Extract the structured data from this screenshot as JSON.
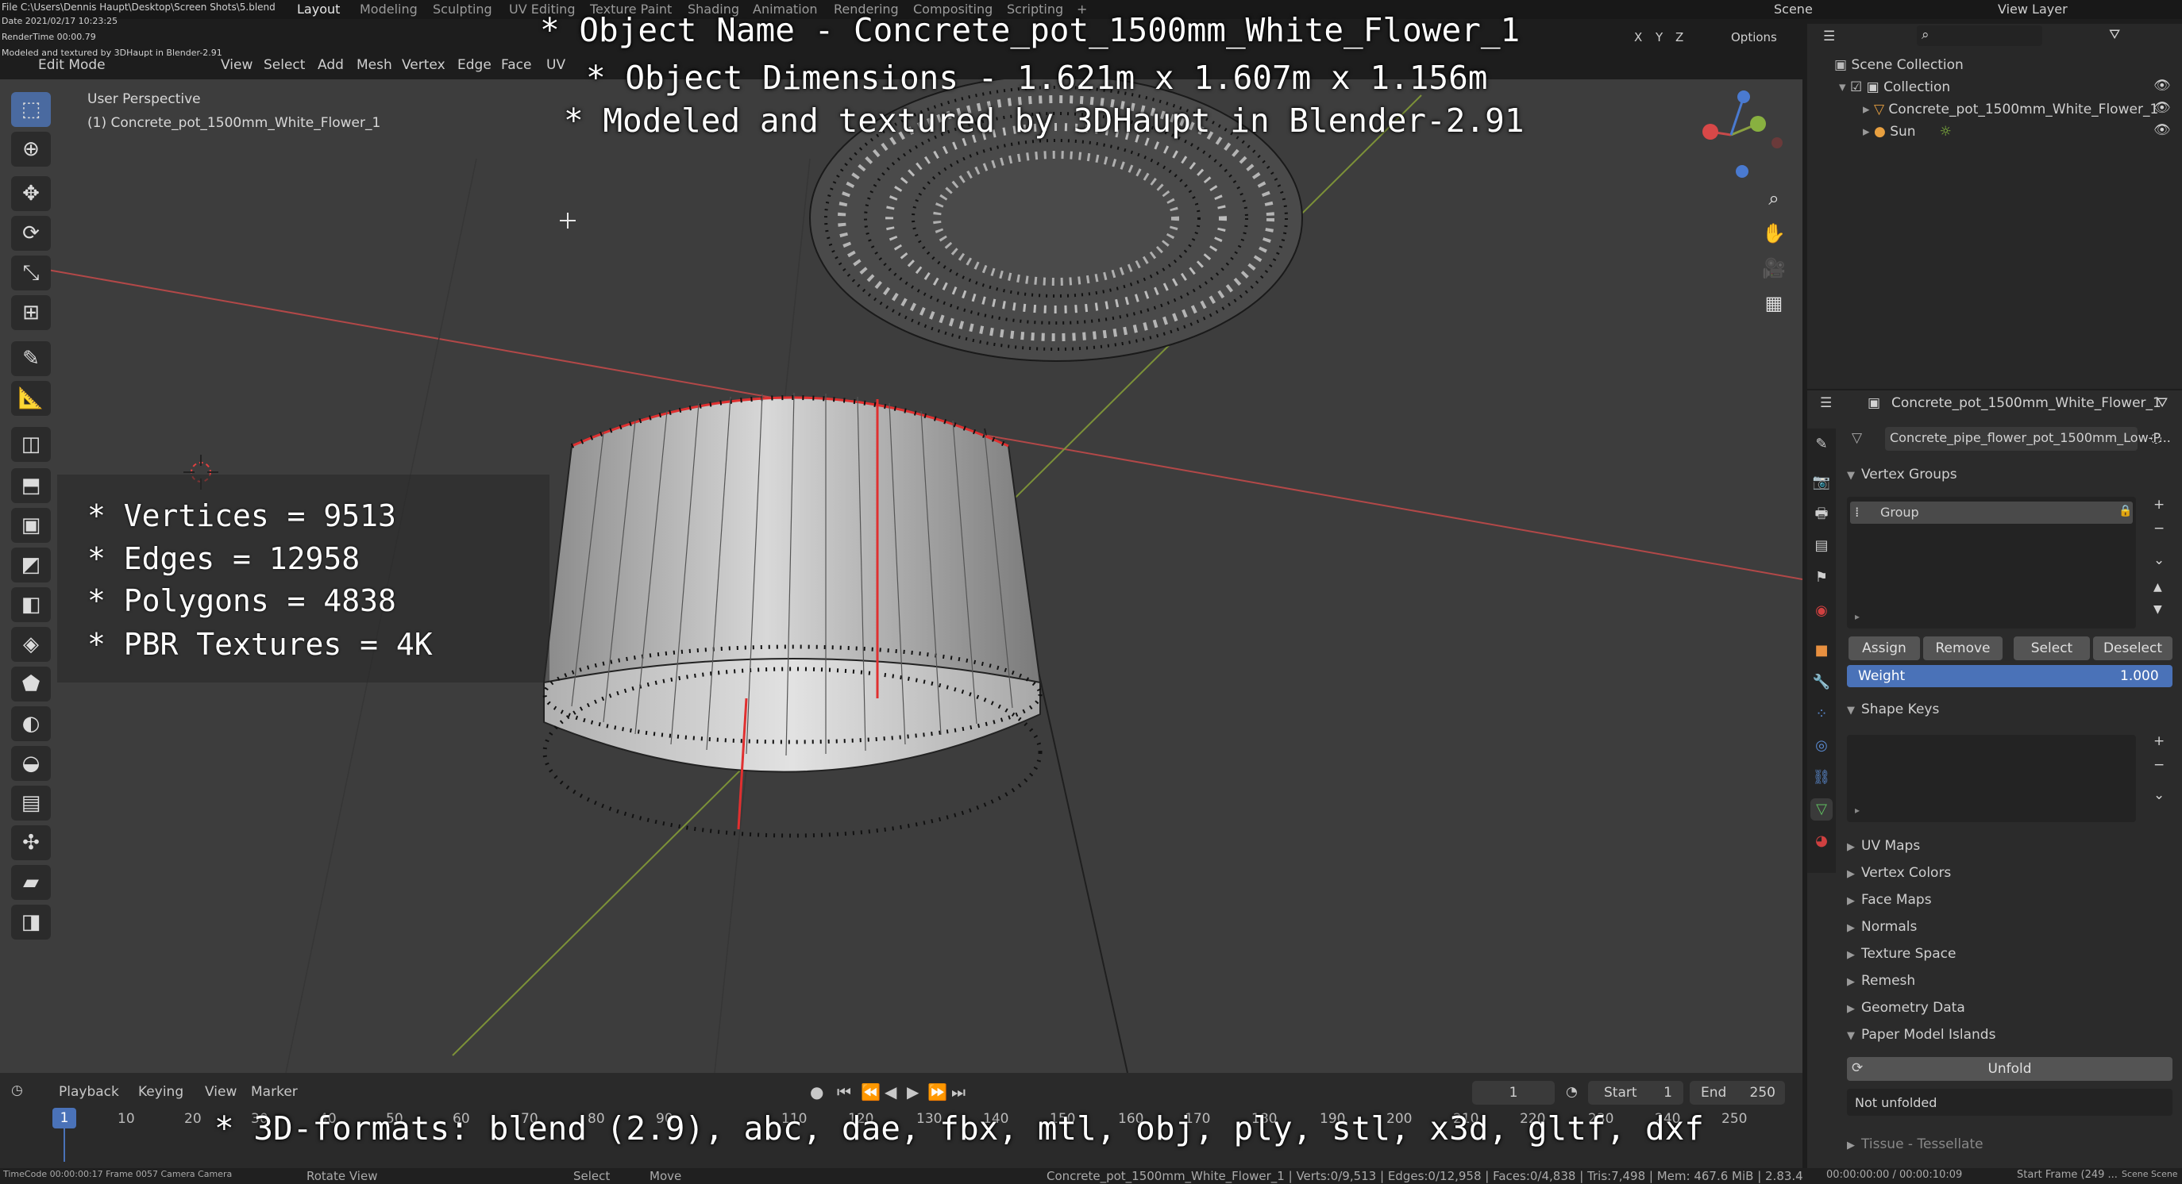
{
  "topbar": {
    "file_path": "File C:\\Users\\Dennis Haupt\\Desktop\\Screen Shots\\5.blend",
    "date": "Date 2021/02/17 10:23:25",
    "rendertime": "RenderTime 00:00.79",
    "note": "Modeled and textured by 3DHaupt in Blender-2.91",
    "tabs": [
      "Layout",
      "Modeling",
      "Sculpting",
      "UV Editing",
      "Texture Paint",
      "Shading",
      "Animation",
      "Rendering",
      "Compositing",
      "Scripting"
    ],
    "active_tab": "Layout",
    "scene": "Scene",
    "view_layer": "View Layer"
  },
  "viewport_header": {
    "mode": "Edit Mode",
    "menus": [
      "View",
      "Select",
      "Add",
      "Mesh",
      "Vertex",
      "Edge",
      "Face",
      "UV"
    ],
    "options": "Options",
    "axes": [
      "X",
      "Y",
      "Z"
    ]
  },
  "viewport": {
    "perspective": "User Perspective",
    "object_caption": "(1) Concrete_pot_1500mm_White_Flower_1"
  },
  "overlay": {
    "line1": "* Object Name - Concrete_pot_1500mm_White_Flower_1",
    "line2": "* Object Dimensions -  1.621m x 1.607m x 1.156m",
    "line3": "* Modeled and textured by 3DHaupt in Blender-2.91",
    "stats": [
      "* Vertices = 9513",
      "* Edges = 12958",
      "* Polygons = 4838",
      "* PBR Textures = 4K"
    ],
    "formats": "* 3D-formats: blend (2.9), abc, dae, fbx, mtl, obj, ply, stl, x3d, gltf, dxf"
  },
  "timeline": {
    "menus": [
      "Playback",
      "Keying",
      "View",
      "Marker"
    ],
    "current_frame": "1",
    "start_label": "Start",
    "start_value": "1",
    "end_label": "End",
    "end_value": "250",
    "ruler": [
      "10",
      "20",
      "30",
      "40",
      "50",
      "60",
      "70",
      "80",
      "90",
      "110",
      "120",
      "130",
      "140",
      "150",
      "160",
      "170",
      "180",
      "190",
      "200",
      "210",
      "220",
      "230",
      "240",
      "250"
    ],
    "ruler_current": "1"
  },
  "statusbar": {
    "left_info": "TimeCode 00:00:00:17   Frame 0057  Camera Camera",
    "rotate": "Rotate View",
    "select": "Select",
    "move": "Move",
    "stats": "Concrete_pot_1500mm_White_Flower_1 | Verts:0/9,513 | Edges:0/12,958 | Faces:0/4,838 | Tris:7,498 | Mem: 467.6 MiB | 2.83.4",
    "right_time": "00:00:00:00 / 00:00:10:09",
    "right_frame": "Start Frame (249 ...",
    "right_scene": "Scene Scene"
  },
  "outliner": {
    "root": "Scene Collection",
    "collection": "Collection",
    "items": [
      "Concrete_pot_1500mm_White_Flower_1",
      "Sun"
    ]
  },
  "properties": {
    "object_name": "Concrete_pot_1500mm_White_Flower_1",
    "mesh_name": "Concrete_pipe_flower_pot_1500mm_Low-P...",
    "vertex_groups_label": "Vertex Groups",
    "group_item": "Group",
    "buttons": [
      "Assign",
      "Remove",
      "Select",
      "Deselect"
    ],
    "weight_label": "Weight",
    "weight_value": "1.000",
    "shape_keys_label": "Shape Keys",
    "collapsed_sections": [
      "UV Maps",
      "Vertex Colors",
      "Face Maps",
      "Normals",
      "Texture Space",
      "Remesh",
      "Geometry Data"
    ],
    "paper_model_label": "Paper Model Islands",
    "unfold_button": "Unfold",
    "not_unfolded": "Not unfolded",
    "tissue_label": "Tissue - Tessellate"
  },
  "colors": {
    "accent_blue": "#4a6aa0",
    "x_axis_red": "#c84a4a",
    "y_axis_green": "#8aa040",
    "seam_red": "#e03030"
  }
}
